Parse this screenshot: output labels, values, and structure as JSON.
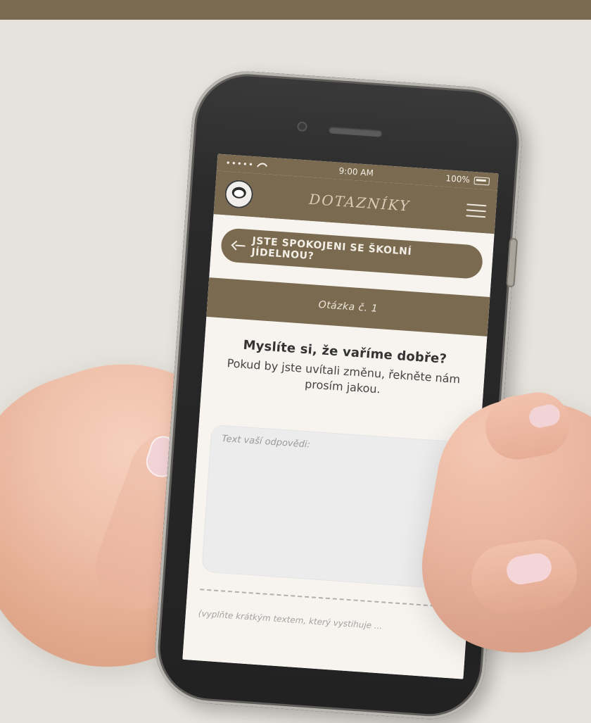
{
  "brand": {
    "primary_color": "#7a6a50",
    "background_color": "#e6e2dc",
    "screen_color": "#f7f4ef"
  },
  "status_bar": {
    "signal": "•••••",
    "time": "9:00 AM",
    "battery": "100%"
  },
  "app_header": {
    "title": "DOTAZNÍKY",
    "avatar_icon": "panda-avatar-icon",
    "menu_icon": "hamburger-menu-icon"
  },
  "survey": {
    "back_title": "JSTE SPOKOJENI SE ŠKOLNÍ JÍDELNOU?",
    "question_tab": "Otázka č. 1",
    "question_title": "Myslíte si, že vaříme dobře?",
    "question_subtitle": "Pokud by jste uvítali změnu, řekněte nám prosím jakou.",
    "answer_placeholder": "Text vaší odpovědi:",
    "hint": "(vyplňte krátkým textem, který vystihuje ..."
  }
}
